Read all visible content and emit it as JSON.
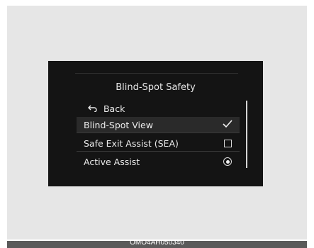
{
  "menu": {
    "title": "Blind-Spot Safety",
    "back_label": "Back",
    "items": [
      {
        "label": "Blind-Spot View",
        "control": "checkbox",
        "checked": true,
        "highlighted": true
      },
      {
        "label": "Safe Exit Assist (SEA)",
        "control": "checkbox",
        "checked": false,
        "highlighted": false
      },
      {
        "label": "Active Assist",
        "control": "radio",
        "checked": true,
        "highlighted": false
      }
    ]
  },
  "caption": {
    "code": "OMO4AH050340"
  },
  "colors": {
    "screen_bg": "#141414",
    "text": "#ececec",
    "highlight": "#2a2a2a",
    "caption_bar": "#5a5a5a"
  },
  "icons": {
    "back": "back-arrow-icon",
    "checked": "checkmark-icon",
    "unchecked": "empty-checkbox-icon",
    "radio": "radio-selected-icon"
  }
}
